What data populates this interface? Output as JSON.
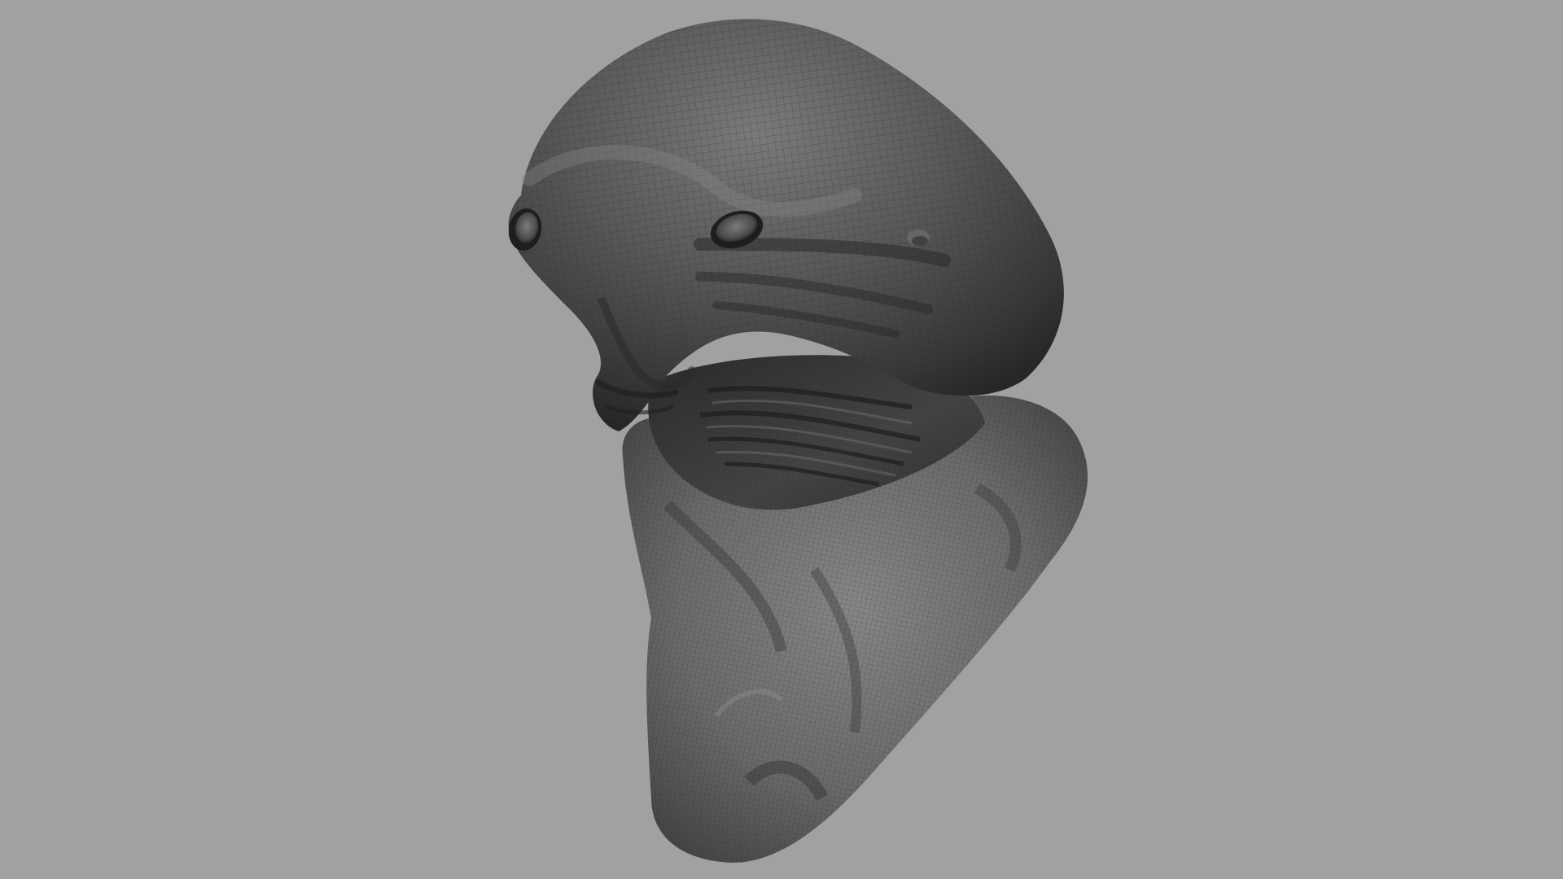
{
  "viewport": {
    "background_color": "#a1a1a1",
    "display_mode": "wireframe-on-shaded",
    "model": {
      "subject": "alien-head-bust",
      "base_color": "#5a5a5a",
      "shadow_color": "#262626",
      "highlight_color": "#8c8c8c",
      "wire_color": "#2a2a2a"
    }
  }
}
